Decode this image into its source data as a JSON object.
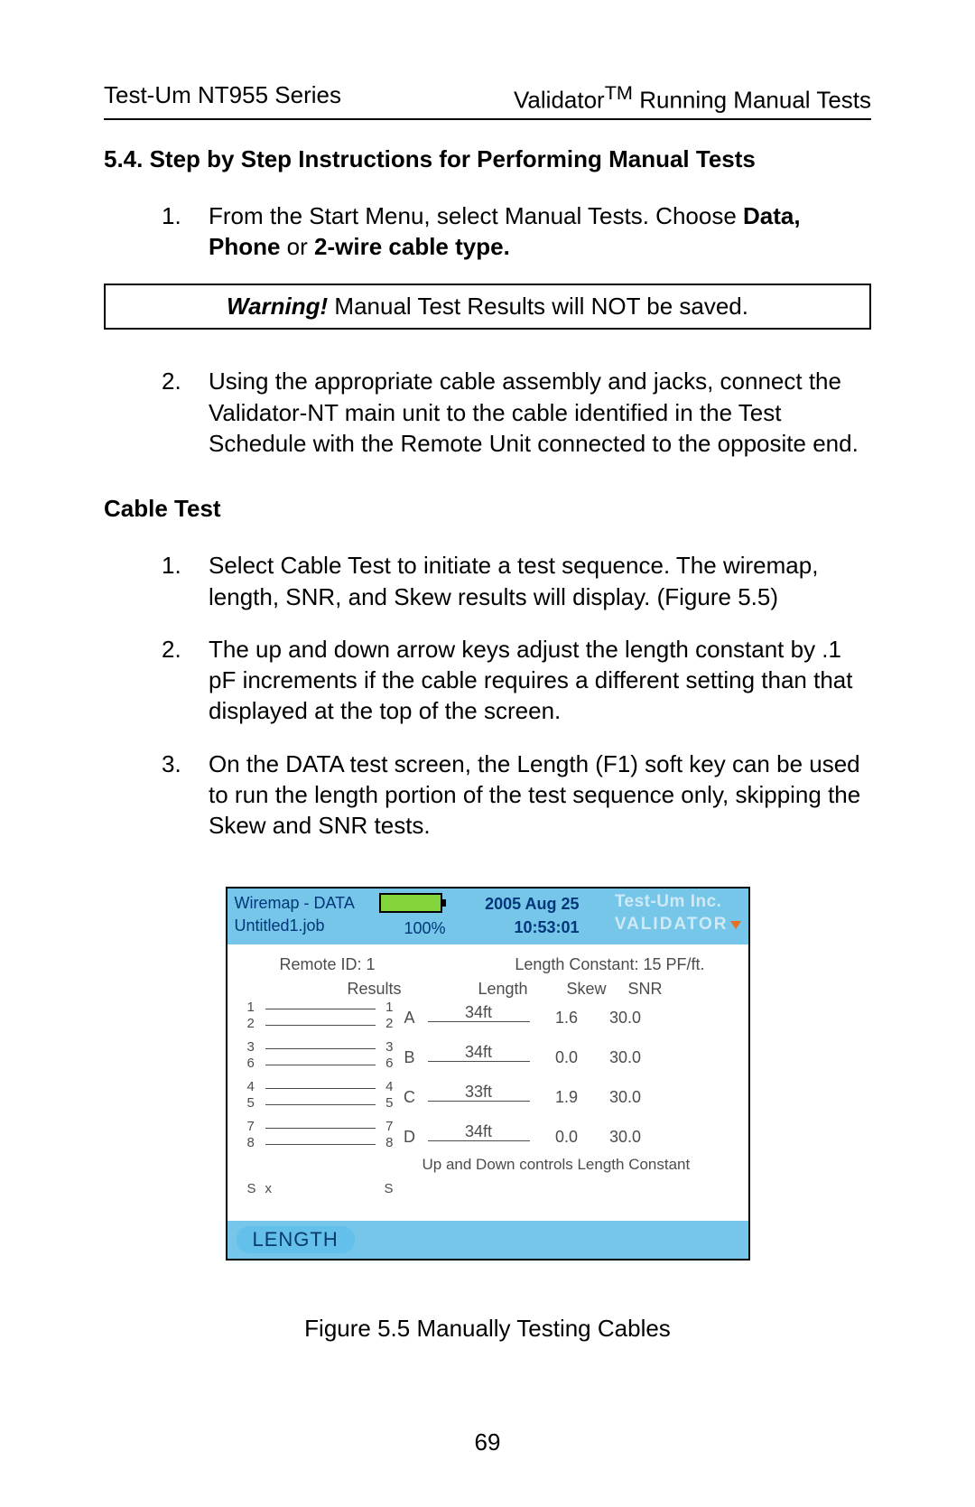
{
  "header": {
    "left": "Test-Um NT955 Series",
    "right_prefix": "Validator",
    "right_tm": "TM",
    "right_suffix": " Running Manual Tests"
  },
  "section": {
    "title": "5.4. Step by Step Instructions for Performing Manual Tests",
    "step1_num": "1.",
    "step1_a": "From the Start Menu, select Manual Tests.  Choose ",
    "step1_bold1": "Data, Phone",
    "step1_b": " or ",
    "step1_bold2": "2-wire cable type.",
    "warning_label": "Warning!",
    "warning_text": " Manual Test Results will NOT be saved.",
    "step2_num": "2.",
    "step2": "Using the appropriate cable assembly and jacks, connect the Validator-NT main unit to the cable identified in the Test Schedule with the Remote Unit connected to the opposite end."
  },
  "cable": {
    "heading": "Cable Test",
    "s1_num": "1.",
    "s1": "Select Cable Test to initiate a test sequence. The wiremap, length, SNR, and Skew results will display. (Figure 5.5)",
    "s2_num": "2.",
    "s2": "The up and down arrow keys adjust the length constant by .1 pF increments if the cable requires a different setting than that displayed at the top of the screen.",
    "s3_num": "3.",
    "s3": "On the DATA test screen, the Length (F1) soft key can be used to run the length portion of the test sequence only, skipping the Skew and SNR tests."
  },
  "device": {
    "title": "Wiremap - DATA",
    "job": "Untitled1.job",
    "battery_pct": "100%",
    "date": "2005 Aug 25",
    "time": "10:53:01",
    "brand1": "Test-Um Inc.",
    "brand2": "VALIDATOR",
    "remote_id": "Remote ID: 1",
    "length_constant": "Length Constant: 15 PF/ft.",
    "h_results": "Results",
    "h_length": "Length",
    "h_skew": "Skew",
    "h_snr": "SNR",
    "pairs": [
      {
        "l1": "1",
        "l2": "2",
        "r1": "1",
        "r2": "2",
        "label": "A",
        "len": "34ft",
        "skew": "1.6",
        "snr": "30.0"
      },
      {
        "l1": "3",
        "l2": "6",
        "r1": "3",
        "r2": "6",
        "label": "B",
        "len": "34ft",
        "skew": "0.0",
        "snr": "30.0"
      },
      {
        "l1": "4",
        "l2": "5",
        "r1": "4",
        "r2": "5",
        "label": "C",
        "len": "33ft",
        "skew": "1.9",
        "snr": "30.0"
      },
      {
        "l1": "7",
        "l2": "8",
        "r1": "7",
        "r2": "8",
        "label": "D",
        "len": "34ft",
        "skew": "0.0",
        "snr": "30.0"
      }
    ],
    "hint": "Up and Down controls Length Constant",
    "shield_l": "S",
    "shield_x": "x",
    "shield_r": "S",
    "softkey": "LENGTH"
  },
  "figure_caption": "Figure 5.5 Manually Testing Cables",
  "page_number": "69"
}
